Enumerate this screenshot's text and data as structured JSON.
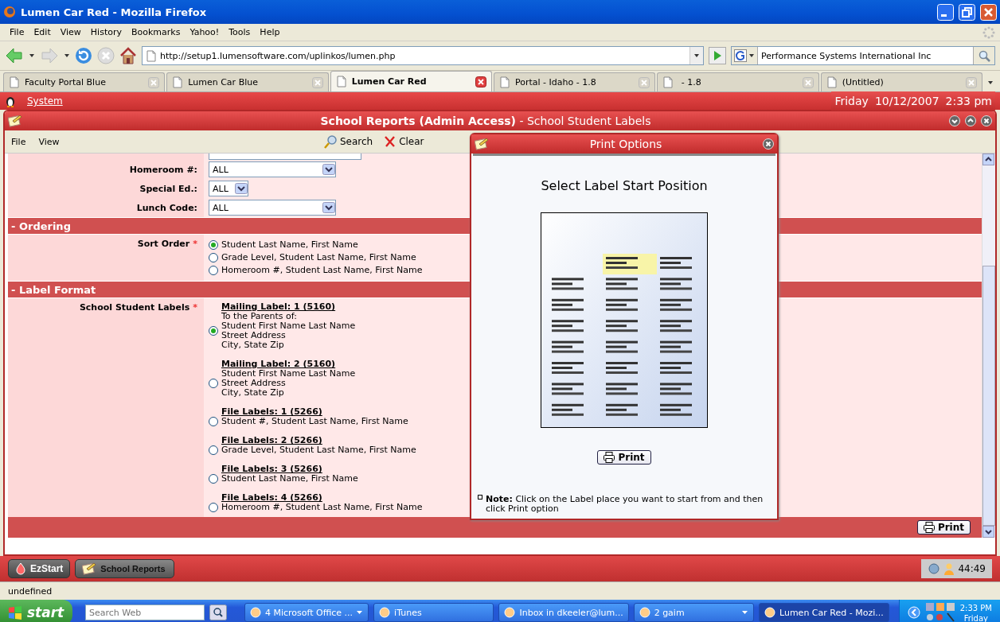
{
  "window": {
    "title": "Lumen Car Red - Mozilla Firefox"
  },
  "menu_bar": [
    "File",
    "Edit",
    "View",
    "History",
    "Bookmarks",
    "Yahoo!",
    "Tools",
    "Help"
  ],
  "address_bar": {
    "value": "http://setup1.lumensoftware.com/uplinkos/lumen.php"
  },
  "search_bar": {
    "value": "Performance Systems International Inc"
  },
  "tabs": [
    {
      "label": "Faculty Portal Blue",
      "selected": false
    },
    {
      "label": "Lumen Car Blue",
      "selected": false
    },
    {
      "label": "Lumen Car Red",
      "selected": true
    },
    {
      "label": "Portal - Idaho - 1.8",
      "selected": false
    },
    {
      "label": " - 1.8",
      "selected": false
    },
    {
      "label": "(Untitled)",
      "selected": false
    }
  ],
  "system_bar": {
    "menu": "System",
    "day": "Friday",
    "date": "10/12/2007",
    "time": "2:33 pm"
  },
  "app_window": {
    "title": "**School Reports (Admin Access)** - School Student Labels"
  },
  "app_menu": [
    "File",
    "View"
  ],
  "toolbar": [
    {
      "kind": "search",
      "label": "Search"
    },
    {
      "kind": "clear",
      "label": "Clear"
    }
  ],
  "filters": [
    {
      "label": "Homeroom #:",
      "value": "ALL",
      "kind": "wide"
    },
    {
      "label": "Special Ed.:",
      "value": "ALL",
      "kind": "narrow"
    },
    {
      "label": "Lunch Code:",
      "value": "ALL",
      "kind": "wide"
    }
  ],
  "sections": [
    {
      "title": "- Ordering",
      "field": {
        "label": "Sort Order",
        "mark": "*",
        "options": [
          {
            "lines": [
              "Student Last Name, First Name"
            ],
            "selected": true
          },
          {
            "lines": [
              "Grade Level, Student Last Name, First Name"
            ],
            "selected": false
          },
          {
            "lines": [
              "Homeroom #, Student Last Name, First Name"
            ],
            "selected": false
          }
        ]
      }
    },
    {
      "title": "- Label Format",
      "field": {
        "label": "School Student Labels",
        "mark": "*",
        "options": [
          {
            "title": "Mailing Label: 1 (5160)",
            "lines": [
              "To the Parents of:",
              "Student First Name Last Name",
              "Street Address",
              "City, State Zip"
            ],
            "selected": true
          },
          {
            "title": "Mailing Label: 2 (5160)",
            "lines": [
              "Student First Name Last Name",
              "Street Address",
              "City, State Zip"
            ],
            "selected": false
          },
          {
            "title": "File Labels: 1 (5266)",
            "lines": [
              "Student #, Student Last Name, First Name"
            ],
            "selected": false
          },
          {
            "title": "File Labels: 2 (5266)",
            "lines": [
              "Grade Level, Student Last Name, First Name"
            ],
            "selected": false
          },
          {
            "title": "File Labels: 3 (5266)",
            "lines": [
              "Student Last Name, First Name"
            ],
            "selected": false
          },
          {
            "title": "File Labels: 4 (5266)",
            "lines": [
              "Homeroom #, Student Last Name, First Name"
            ],
            "selected": false
          }
        ]
      }
    }
  ],
  "footer": {
    "print": "Print"
  },
  "dialog": {
    "title": "Print Options",
    "heading": "Select Label Start Position",
    "print": "Print",
    "note": "**Note:** Click on the Label place you want to start from and then click Print option"
  },
  "app_taskbar": {
    "buttons": [
      {
        "kind": "start",
        "label": "EzStart"
      },
      {
        "kind": "app",
        "label": "School Reports"
      }
    ],
    "counter": "44:49"
  },
  "status_bar": "undefined",
  "taskbar": {
    "start": "start",
    "search_placeholder": "Search Web",
    "items": [
      {
        "kind": "group",
        "label": "4 Microsoft Office ...",
        "selected": false
      },
      {
        "kind": "single",
        "label": "iTunes",
        "selected": false
      },
      {
        "kind": "single",
        "label": "Inbox in dkeeler@lum...",
        "selected": false
      },
      {
        "kind": "group",
        "label": "2 gaim",
        "selected": false
      },
      {
        "kind": "single",
        "label": "Lumen Car Red - Mozi...",
        "selected": true
      }
    ],
    "clock": "2:33 PM",
    "day": "Friday"
  }
}
